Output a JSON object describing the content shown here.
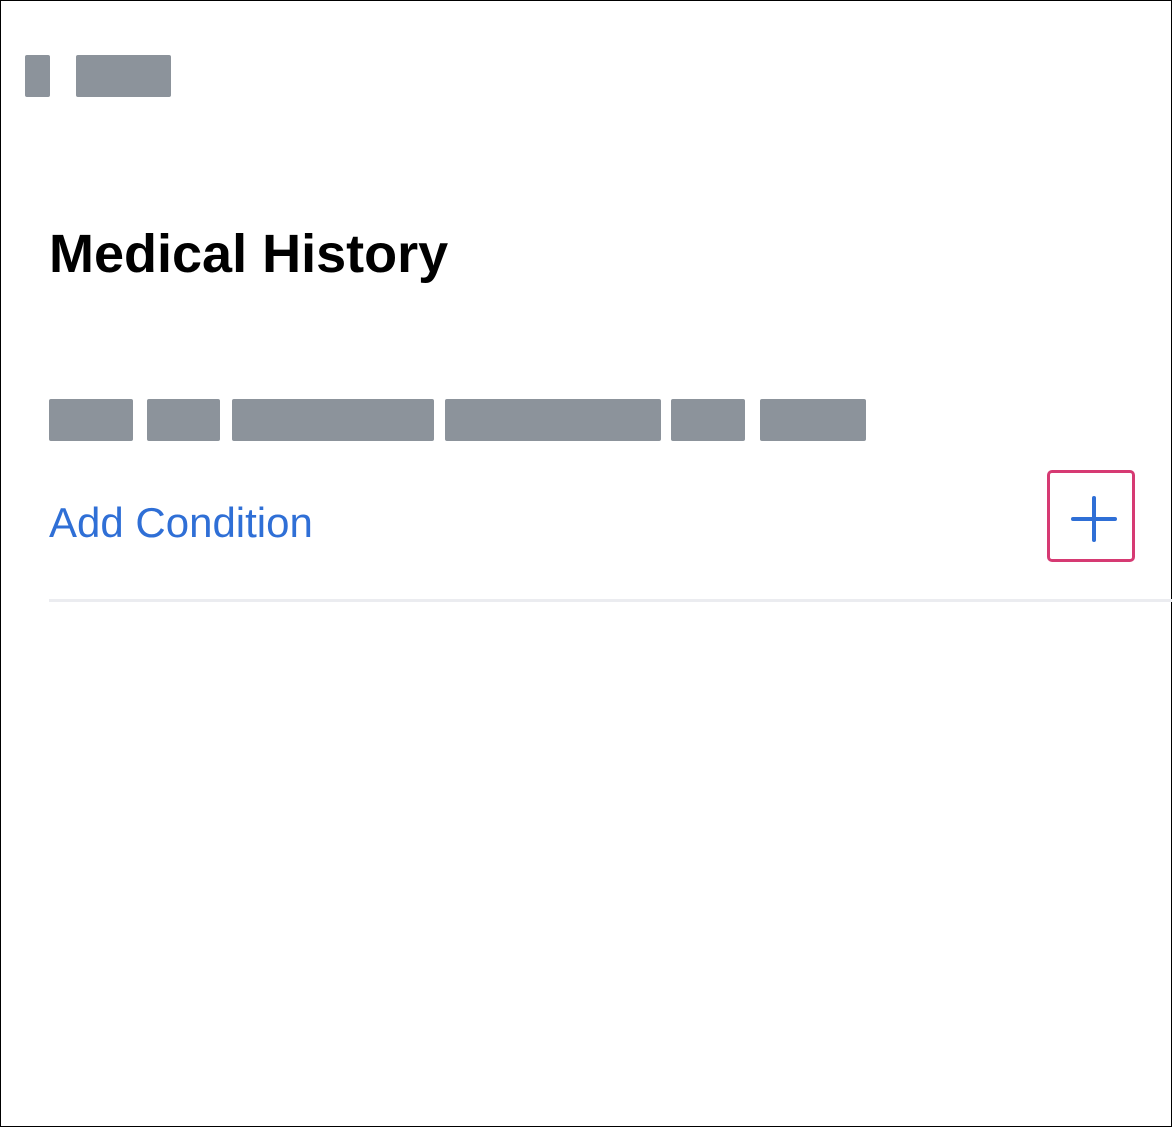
{
  "header": {
    "redacted_blocks": [
      "back-control",
      "nav-label"
    ]
  },
  "page": {
    "title": "Medical History",
    "description_redacted_word_count": 6
  },
  "conditions": {
    "add_label": "Add Condition",
    "add_icon": "plus-icon"
  },
  "colors": {
    "link": "#2f6fd6",
    "highlight_border": "#d63a73",
    "redaction": "#8c939b",
    "divider": "#ebecf0"
  }
}
